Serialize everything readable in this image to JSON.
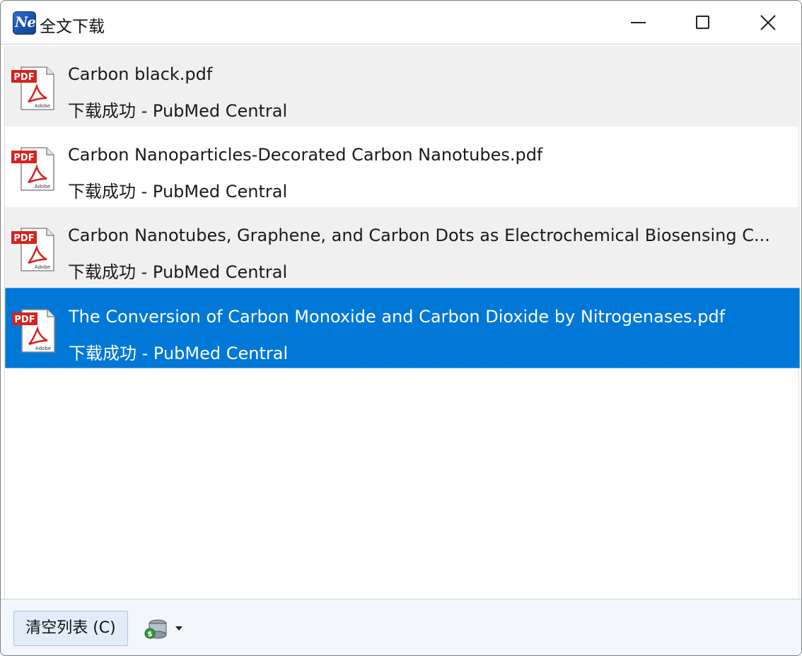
{
  "window": {
    "title": "全文下载",
    "app_icon_text": "Ne"
  },
  "downloads": [
    {
      "filename": "Carbon black.pdf",
      "status": "下载成功",
      "separator": "-",
      "source": "PubMed Central",
      "shaded": true,
      "selected": false
    },
    {
      "filename": "Carbon Nanoparticles-Decorated Carbon Nanotubes.pdf",
      "status": "下载成功",
      "separator": "-",
      "source": "PubMed Central",
      "shaded": false,
      "selected": false
    },
    {
      "filename": "Carbon Nanotubes, Graphene, and Carbon Dots as Electrochemical Biosensing  C...",
      "status": "下载成功",
      "separator": "-",
      "source": "PubMed Central",
      "shaded": true,
      "selected": false
    },
    {
      "filename": "The Conversion of Carbon Monoxide and Carbon Dioxide by Nitrogenases.pdf",
      "status": "下载成功",
      "separator": "-",
      "source": "PubMed Central",
      "shaded": false,
      "selected": true
    }
  ],
  "icons": {
    "file": "pdf-file-icon",
    "file_badge": "PDF",
    "file_brand": "Adobe"
  },
  "footer": {
    "clear_label": "清空列表 (C)",
    "tool_icon": "database-settings-icon"
  },
  "colors": {
    "selection": "#0078d7",
    "shaded_row": "#f0f0f0",
    "pdf_red": "#d6231e"
  }
}
